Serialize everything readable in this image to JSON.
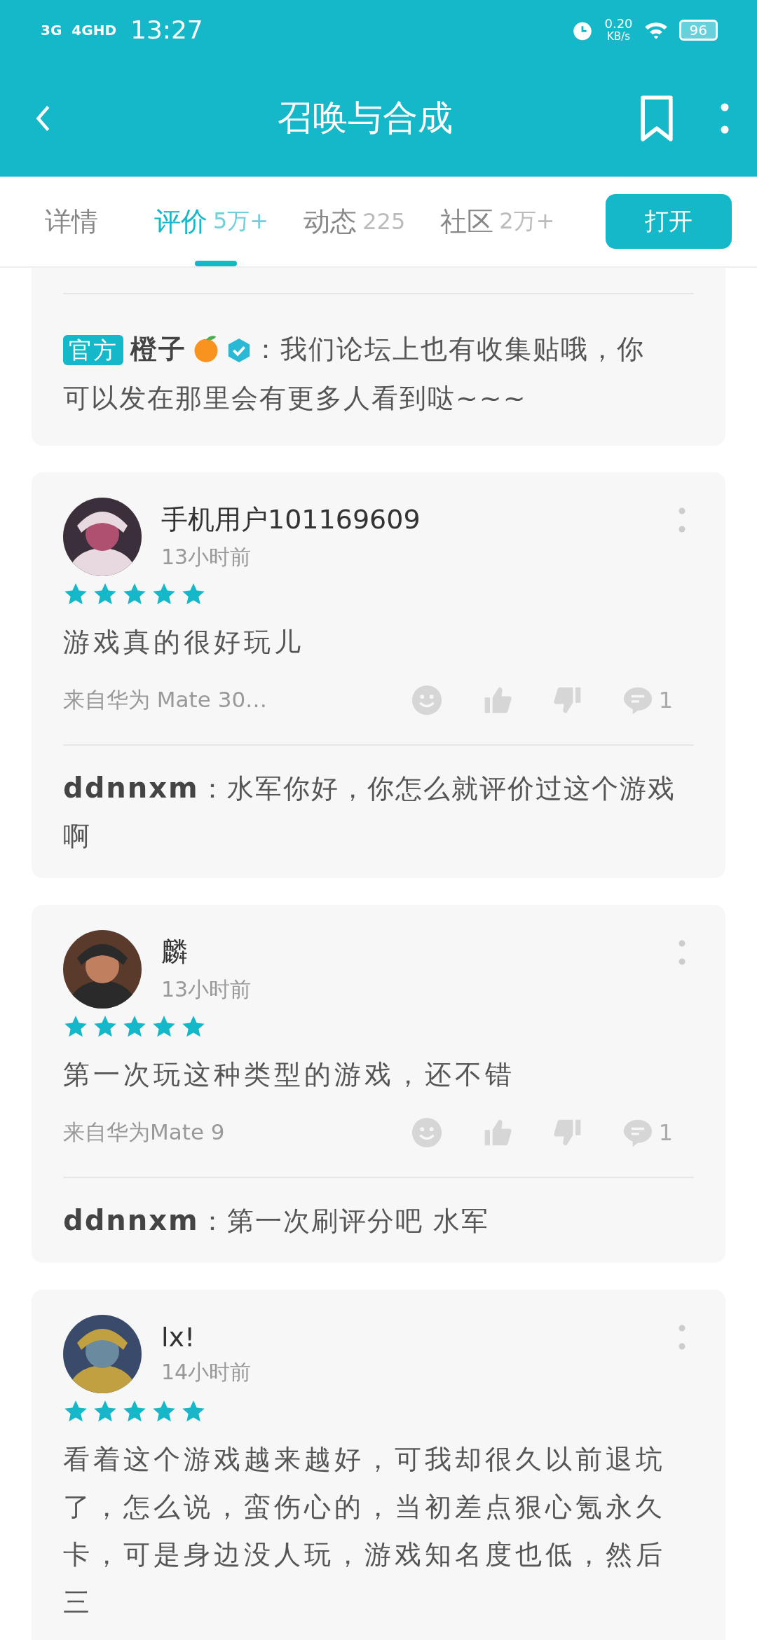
{
  "status_bar": {
    "network_1": "3G",
    "network_2": "4GHD",
    "time": "13:27",
    "speed": "0.20",
    "speed_unit": "KB/s",
    "battery": "96"
  },
  "header": {
    "title": "召唤与合成"
  },
  "tabs": [
    {
      "label": "详情",
      "selected": false
    },
    {
      "label": "评价",
      "count": "5万+",
      "selected": true
    },
    {
      "label": "动态",
      "count": "225",
      "selected": false
    },
    {
      "label": "社区",
      "count": "2万+",
      "selected": false
    }
  ],
  "open_button": "打开",
  "official_reply": {
    "badge": "官方",
    "user": "橙子",
    "text_lines": [
      "：我们论坛上也有收集贴哦，你",
      "可以发在那里会有更多人看到哒~~~"
    ]
  },
  "reviews": [
    {
      "user": "手机用户101169609",
      "time": "13小时前",
      "stars": 5,
      "text": "游戏真的很好玩儿",
      "device": "来自华为 Mate 30…",
      "comments": "1",
      "reply": "**ddnnxm**：水军你好，你怎么就评价过这个游戏啊"
    },
    {
      "user": "麟",
      "time": "13小时前",
      "stars": 5,
      "text": "第一次玩这种类型的游戏，还不错",
      "device": "来自华为Mate 9",
      "comments": "1",
      "reply": "**ddnnxm**：第一次刷评分吧 水军"
    },
    {
      "user": "lx!",
      "time": "14小时前",
      "stars": 5,
      "text": "看着这个游戏越来越好，可我却很久以前退坑了，怎么说，蛮伤心的，当初差点狠心氪永久卡，可是身边没人玩，游戏知名度也低，然后三"
    }
  ]
}
